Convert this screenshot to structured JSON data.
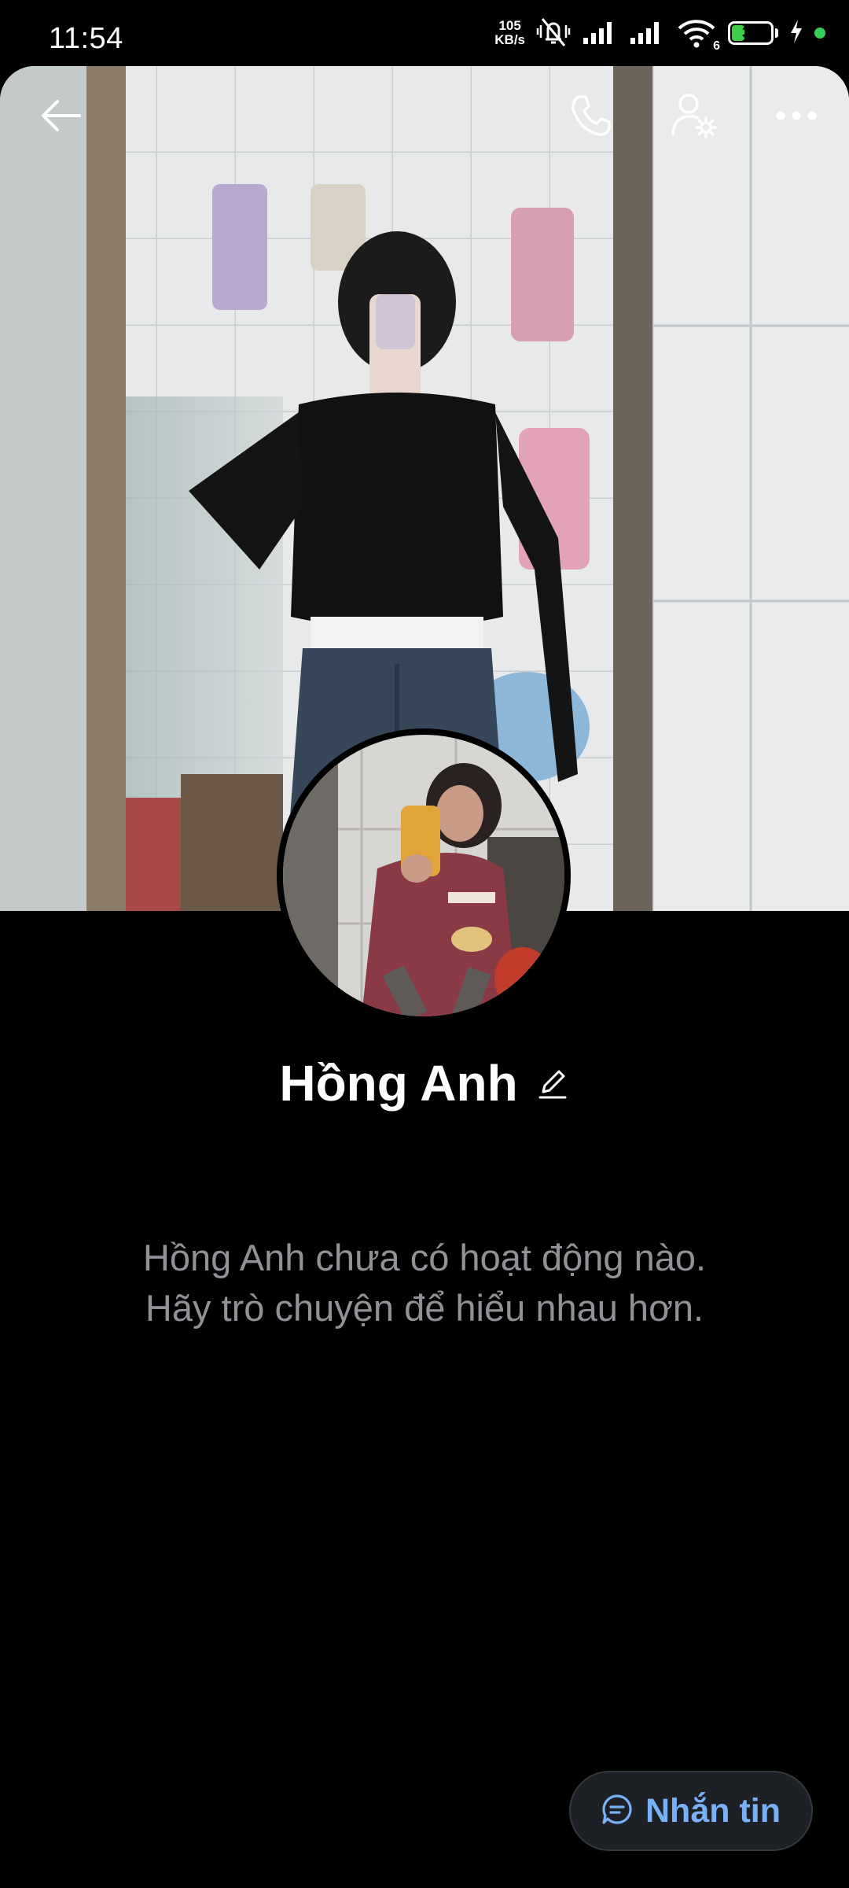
{
  "status_bar": {
    "time": "11:54",
    "net_speed_value": "105",
    "net_speed_unit": "KB/s",
    "signal_label": "6",
    "battery_level": "38",
    "battery_fraction": 0.38,
    "charging_icon": "bolt-icon",
    "dot_color": "#35d05a"
  },
  "top_bar": {
    "back_icon": "arrow-left-icon",
    "call_icon": "phone-icon",
    "settings_icon": "user-settings-icon",
    "more_icon": "more-horizontal-icon"
  },
  "profile": {
    "name": "Hồng Anh",
    "edit_icon": "pencil-icon"
  },
  "empty_state": {
    "line1": "Hồng Anh chưa có hoạt động nào.",
    "line2": "Hãy trò chuyện để hiểu nhau hơn."
  },
  "message_button": {
    "label": "Nhắn tin",
    "icon": "chat-bubble-icon",
    "accent_color": "#7ab0f5"
  }
}
